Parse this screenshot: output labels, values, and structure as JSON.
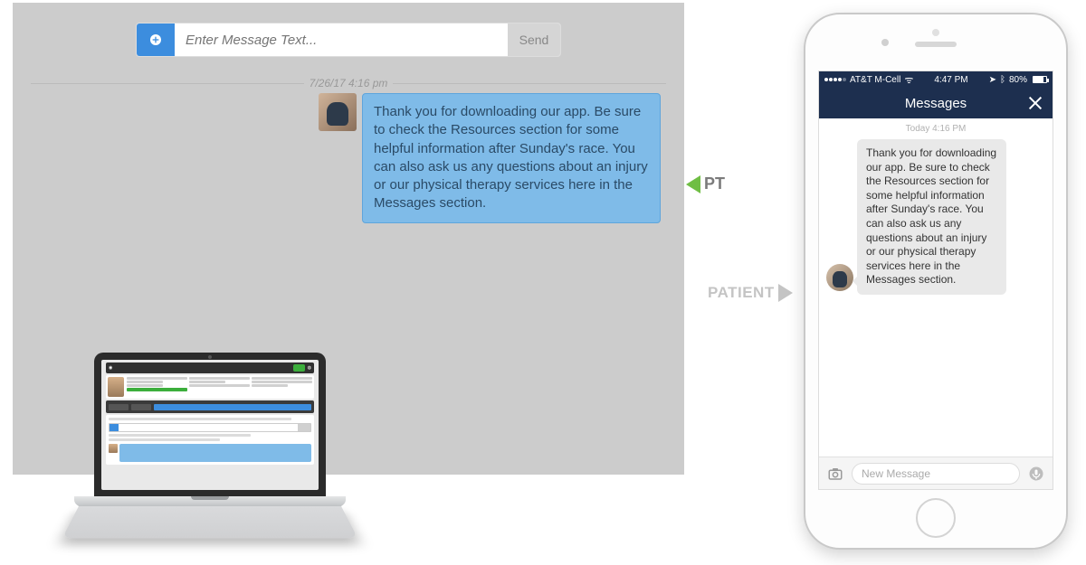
{
  "desktop": {
    "compose": {
      "placeholder": "Enter Message Text...",
      "send_label": "Send"
    },
    "thread": {
      "timestamp": "7/26/17  4:16 pm",
      "message": "Thank you for downloading our app. Be sure to check the Resources section for some helpful information after Sunday's race. You can also ask us any questions about an injury or our physical therapy services here in the Messages section."
    }
  },
  "labels": {
    "pt": "PT",
    "patient": "PATIENT"
  },
  "phone": {
    "statusbar": {
      "carrier": "AT&T M-Cell",
      "time": "4:47 PM",
      "battery": "80%"
    },
    "nav_title": "Messages",
    "thread": {
      "timestamp": "Today 4:16 PM",
      "message": "Thank you for downloading our app. Be sure to check the Resources section for some helpful information after Sunday's race. You can also ask us any questions about an injury or our physical therapy services here in the Messages section."
    },
    "compose_placeholder": "New Message"
  }
}
